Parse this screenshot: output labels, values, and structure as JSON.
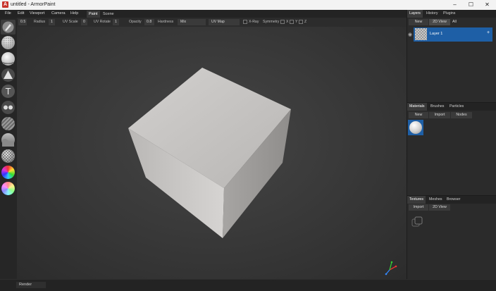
{
  "window": {
    "logo_letter": "A",
    "title": "untitled - ArmorPaint",
    "buttons": [
      "–",
      "☐",
      "✕"
    ]
  },
  "menu": {
    "items": [
      "File",
      "Edit",
      "Viewport",
      "Camera",
      "Help"
    ],
    "tabs": [
      "Paint",
      "Scene"
    ],
    "active_tab": "Paint"
  },
  "toolbar": {
    "radius_value": "0.5",
    "radius_label": "Radius",
    "uv_scale_value": "1",
    "uv_scale_label": "UV Scale",
    "uv_rotate_value": "0",
    "uv_rotate_label": "UV Rotate",
    "opacity_value": "1",
    "opacity_label": "Opacity",
    "hardness_value": "0.8",
    "hardness_label": "Hardness",
    "blend_selected": "Mix",
    "uv_map_selected": "UV Map",
    "xray_label": "X-Ray",
    "symmetry_label": "Symmetry",
    "sym_x": "X",
    "sym_y": "Y",
    "sym_z": "Z"
  },
  "status": {
    "render_button": "Render"
  },
  "layers_panel": {
    "tabs": [
      "Layers",
      "History",
      "Plugins"
    ],
    "new_button": "New",
    "view_button": "2D View",
    "filter": "All",
    "layer_name": "Layer 1",
    "accent": "#1e5fa6"
  },
  "materials_panel": {
    "tabs": [
      "Materials",
      "Brushes",
      "Particles"
    ],
    "new_button": "New",
    "import_button": "Import",
    "nodes_button": "Nodes"
  },
  "textures_panel": {
    "tabs": [
      "Textures",
      "Meshes",
      "Browser"
    ],
    "import_button": "Import",
    "view_button": "2D View"
  },
  "tools": [
    "brush-tool",
    "eraser-tool",
    "fill-tool",
    "decal-tool",
    "text-tool",
    "clone-tool",
    "blur-tool",
    "particle-tool",
    "bake-tool",
    "color-id-tool",
    "picker-tool"
  ]
}
